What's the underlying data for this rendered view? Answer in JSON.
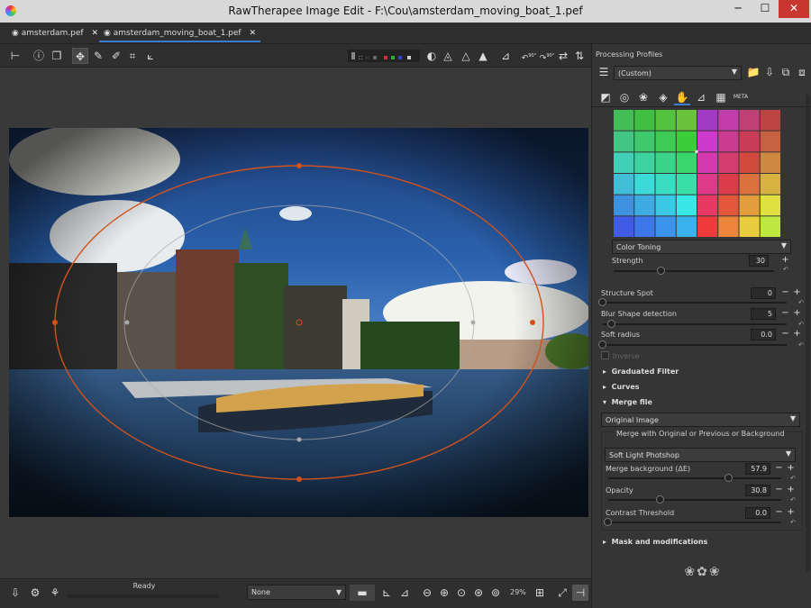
{
  "window": {
    "title": "RawTherapee Image Edit - F:\\Cou\\amsterdam_moving_boat_1.pef",
    "minimize": "─",
    "maximize": "☐",
    "close": "✕"
  },
  "tabs": [
    {
      "label": "amsterdam.pef",
      "close": "✕"
    },
    {
      "label": "amsterdam_moving_boat_1.pef",
      "close": "✕"
    }
  ],
  "toolbar": {
    "icons": [
      "history-panel-icon",
      "info-icon",
      "before-after-icon",
      "hand-icon",
      "color-picker-icon",
      "white-balance-picker-icon",
      "crop-icon",
      "straighten-icon",
      "focus-mask-icon",
      "clipping-shadow-icon",
      "clipping-highlight-icon",
      "histogram-icon",
      "rotate-left-icon",
      "rotate-right-icon",
      "flip-horizontal-icon",
      "flip-vertical-icon"
    ],
    "rotate_left_label": "90°",
    "rotate_right_label": "90°"
  },
  "status": {
    "text": "Ready"
  },
  "bottom": {
    "profile_select": "None",
    "zoom": "29%"
  },
  "right": {
    "profiles_title": "Processing Profiles",
    "profile_value": "(Custom)",
    "tool_tabs": [
      "exposure-tab-icon",
      "detail-tab-icon",
      "color-tab-icon",
      "advanced-tab-icon",
      "locallab-tab-icon",
      "transform-tab-icon",
      "raw-tab-icon",
      "meta-tab-icon"
    ],
    "meta_label": "META",
    "color_toning": "Color Toning",
    "strength": {
      "label": "Strength",
      "value": "30",
      "fraction": 0.3
    },
    "structure_spot": {
      "label": "Structure Spot",
      "value": "0",
      "fraction": 0.0
    },
    "blur_shape": {
      "label": "Blur Shape detection",
      "value": "5",
      "fraction": 0.05
    },
    "soft_radius": {
      "label": "Soft radius",
      "value": "0.0",
      "fraction": 0.0
    },
    "inverse": {
      "label": "Inverse"
    },
    "sections": {
      "graduated": "Graduated Filter",
      "curves": "Curves",
      "merge": "Merge file",
      "mask": "Mask and modifications"
    },
    "merge_source": "Original Image",
    "merge_group_title": "Merge with Original or Previous or Background",
    "blend_mode": "Soft Light Photshop",
    "merge_bg": {
      "label": "Merge background (ΔE)",
      "value": "57.9",
      "fraction": 0.7
    },
    "opacity": {
      "label": "Opacity",
      "value": "30.8",
      "fraction": 0.3
    },
    "contrast_threshold": {
      "label": "Contrast Threshold",
      "value": "0.0",
      "fraction": 0.0
    },
    "plus": "+",
    "minus": "−",
    "reset": "↶",
    "expander_closed": "▸",
    "expander_open": "▾"
  },
  "colors": {
    "accent": "#3a7bd5",
    "spot_outer": "#d2521b",
    "spot_inner": "#aaaaaa"
  }
}
